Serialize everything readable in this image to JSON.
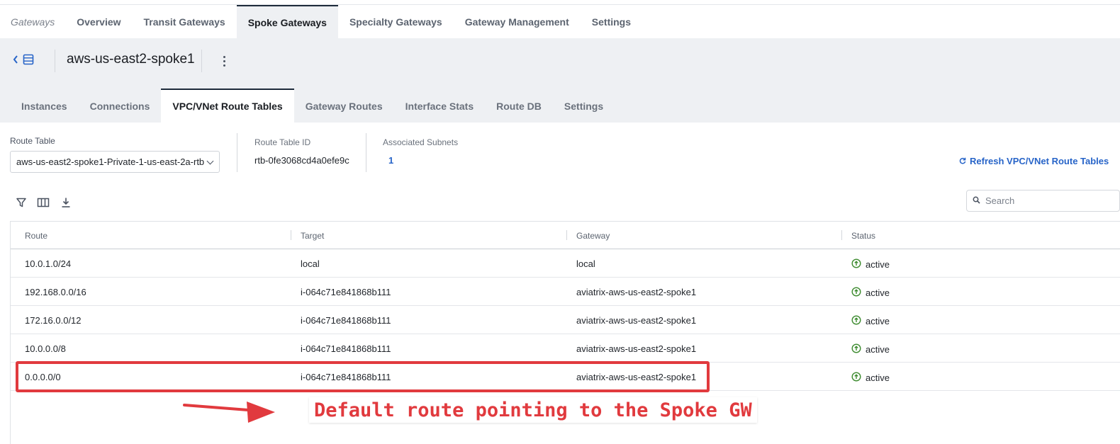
{
  "topnav": {
    "breadcrumb": "Gateways",
    "tabs": [
      "Overview",
      "Transit Gateways",
      "Spoke Gateways",
      "Specialty Gateways",
      "Gateway Management",
      "Settings"
    ],
    "active_tab": "Spoke Gateways"
  },
  "header": {
    "gateway_name": "aws-us-east2-spoke1"
  },
  "subtabs": {
    "tabs": [
      "Instances",
      "Connections",
      "VPC/VNet Route Tables",
      "Gateway Routes",
      "Interface Stats",
      "Route DB",
      "Settings"
    ],
    "active_tab": "VPC/VNet Route Tables"
  },
  "route_table": {
    "label": "Route Table",
    "selected": "aws-us-east2-spoke1-Private-1-us-east-2a-rtb",
    "id_label": "Route Table ID",
    "id_value": "rtb-0fe3068cd4a0efe9c",
    "subnets_label": "Associated Subnets",
    "subnets_value": "1",
    "refresh_label": "Refresh VPC/VNet Route Tables"
  },
  "search": {
    "placeholder": "Search"
  },
  "table": {
    "columns": [
      "Route",
      "Target",
      "Gateway",
      "Status"
    ],
    "rows": [
      {
        "route": "10.0.1.0/24",
        "target": "local",
        "gateway": "local",
        "status": "active"
      },
      {
        "route": "192.168.0.0/16",
        "target": "i-064c71e841868b111",
        "gateway": "aviatrix-aws-us-east2-spoke1",
        "status": "active"
      },
      {
        "route": "172.16.0.0/12",
        "target": "i-064c71e841868b111",
        "gateway": "aviatrix-aws-us-east2-spoke1",
        "status": "active"
      },
      {
        "route": "10.0.0.0/8",
        "target": "i-064c71e841868b111",
        "gateway": "aviatrix-aws-us-east2-spoke1",
        "status": "active"
      },
      {
        "route": "0.0.0.0/0",
        "target": "i-064c71e841868b111",
        "gateway": "aviatrix-aws-us-east2-spoke1",
        "status": "active"
      }
    ]
  },
  "annotation": {
    "text": "Default route pointing to the Spoke GW",
    "color": "#e13a3e"
  },
  "colors": {
    "accent": "#2764c8",
    "status_active": "#3d8b2f",
    "band": "#eef0f3"
  },
  "icons": {
    "back": "chevron-left-icon",
    "list": "list-view-icon",
    "more": "kebab-menu-icon",
    "refresh": "refresh-icon",
    "filter": "filter-icon",
    "columns": "columns-icon",
    "download": "download-icon",
    "search": "search-icon",
    "status": "arrow-up-circle-icon"
  }
}
